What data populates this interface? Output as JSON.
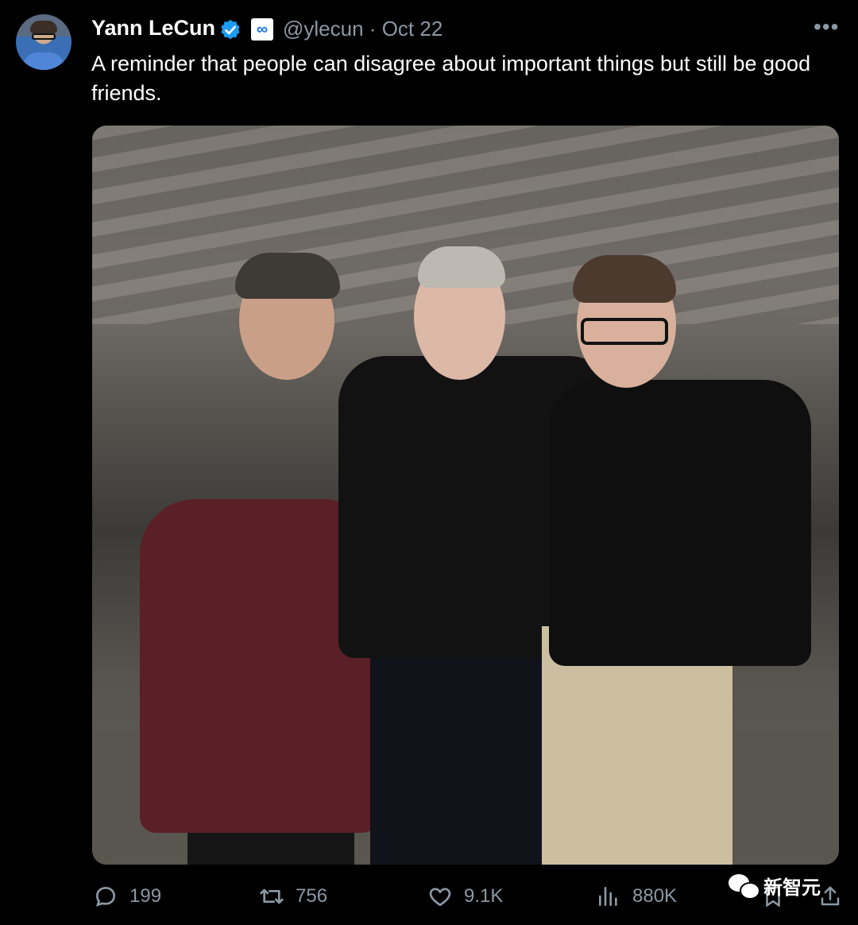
{
  "tweet": {
    "author_name": "Yann LeCun",
    "handle": "@ylecun",
    "separator": "·",
    "date": "Oct 22",
    "body": "A reminder that people can disagree about important things but still be good friends.",
    "more_icon": "more-horizontal-icon",
    "verified_icon": "verified-badge-icon",
    "affiliation_icon": "meta-logo-icon",
    "affiliation_glyph": "∞"
  },
  "actions": {
    "replies": "199",
    "retweets": "756",
    "likes": "9.1K",
    "views": "880K"
  },
  "watermark": {
    "text": "新智元"
  },
  "colors": {
    "background": "#000000",
    "text": "#ffffff",
    "muted": "#8b98a5",
    "verified": "#1d9bf0"
  }
}
